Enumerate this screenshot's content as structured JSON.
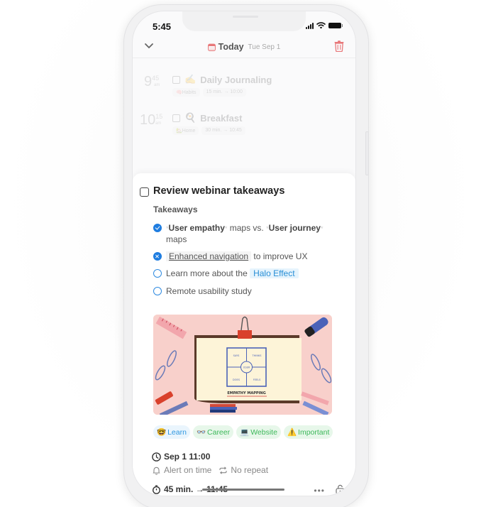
{
  "status_bar": {
    "time": "5:45"
  },
  "header": {
    "title": "Today",
    "date": "Tue Sep 1",
    "collapse_icon": "chevron-down-icon",
    "calendar_icon": "calendar-icon",
    "delete_icon": "trash-icon"
  },
  "background_tasks": [
    {
      "hour": "9",
      "minute": "45",
      "ampm": "am",
      "emoji": "✍️",
      "title": "Daily Journaling",
      "tag": "Habits",
      "tag_emoji": "🧠",
      "duration": "15 min. → 10:00"
    },
    {
      "hour": "10",
      "minute": "15",
      "ampm": "am",
      "emoji": "🍳",
      "title": "Breakfast",
      "tag": "Home",
      "tag_emoji": "🏡",
      "duration": "30 min. → 10:45"
    }
  ],
  "task": {
    "title": "Review webinar takeaways",
    "completed": false,
    "section_label": "Takeaways",
    "todos": [
      {
        "state": "done",
        "parts": [
          "User empathy",
          " maps vs. ",
          "User journey",
          " maps"
        ]
      },
      {
        "state": "cancelled",
        "link": "Enhanced navigation",
        "rest": " to improve UX"
      },
      {
        "state": "open",
        "prefix": "Learn more about the ",
        "highlight": "Halo Effect"
      },
      {
        "state": "open",
        "text": "Remote usability study"
      }
    ],
    "image": {
      "caption": "EMPATHY MAPPING",
      "quadrants": [
        "SAYS",
        "THINKS",
        "DOES",
        "FEELS"
      ],
      "center": "USER"
    },
    "tags": [
      {
        "emoji": "🤓",
        "label": "Learn",
        "color": "#2e97e0"
      },
      {
        "emoji": "👓",
        "label": "Career",
        "color": "#3db85a"
      },
      {
        "emoji": "💻",
        "label": "Website",
        "color": "#3db85a"
      },
      {
        "emoji": "⚠️",
        "label": "Important",
        "color": "#3db85a"
      }
    ],
    "datetime": "Sep 1 11:00",
    "alert": "Alert on time",
    "repeat": "No repeat",
    "duration": "45 min. → 11:45",
    "more_label": "•••"
  },
  "colors": {
    "accent_blue": "#1f7de0",
    "delete_red": "#e8787a",
    "tag_green": "#3db85a"
  }
}
